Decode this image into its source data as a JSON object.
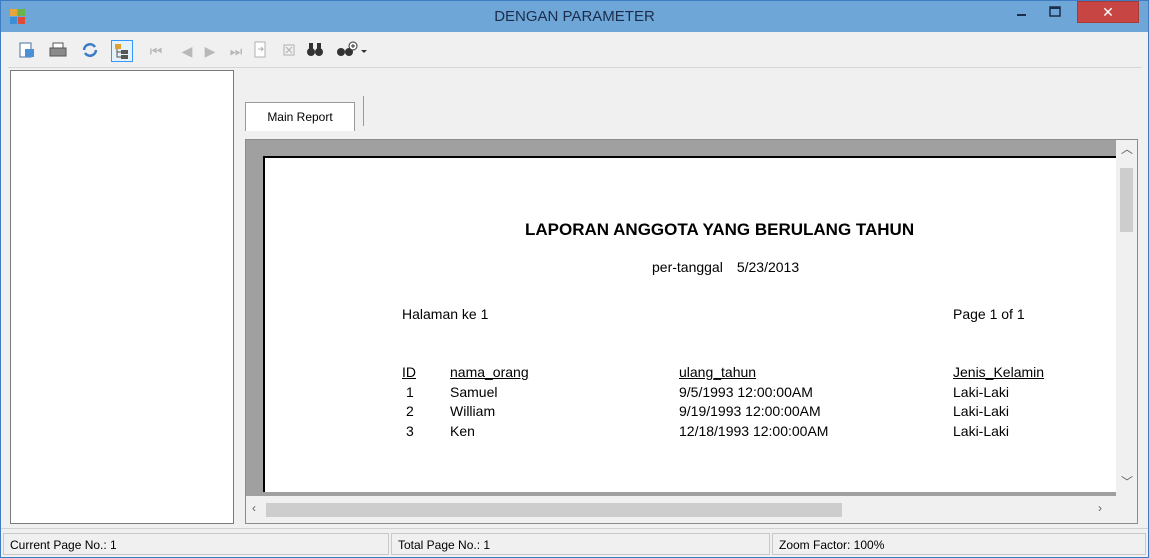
{
  "window": {
    "title": "DENGAN PARAMETER",
    "close_glyph": "✕",
    "min_glyph": "–",
    "max_glyph": "☐"
  },
  "toolbar": {
    "buttons": [
      {
        "name": "export-icon",
        "glyph": "▣"
      },
      {
        "name": "print-icon",
        "glyph": "⎙"
      },
      {
        "name": "refresh-icon",
        "glyph": "⟳"
      },
      {
        "name": "group-tree-toggle-icon",
        "glyph": "☷"
      },
      {
        "name": "first-page-icon",
        "glyph": "|◀"
      },
      {
        "name": "previous-page-icon",
        "glyph": "◀"
      },
      {
        "name": "next-page-icon",
        "glyph": "▶"
      },
      {
        "name": "last-page-icon",
        "glyph": "▶|"
      },
      {
        "name": "go-to-page-icon",
        "glyph": "⇲"
      },
      {
        "name": "stop-icon",
        "glyph": "⊠"
      },
      {
        "name": "search-text-icon",
        "glyph": "⚲"
      },
      {
        "name": "zoom-icon",
        "glyph": "⚲+"
      }
    ]
  },
  "tab": {
    "label": "Main Report"
  },
  "report": {
    "title": "LAPORAN ANGGOTA YANG BERULANG TAHUN",
    "subtitle_label": "per-tanggal",
    "subtitle_date": "5/23/2013",
    "halaman": "Halaman ke 1",
    "page_of": "Page 1 of 1",
    "columns": [
      "ID",
      "nama_orang",
      "ulang_tahun",
      "Jenis_Kelamin"
    ],
    "rows": [
      {
        "id": "1",
        "nama": "Samuel",
        "ulang": "9/5/1993  12:00:00AM",
        "jk": "Laki-Laki"
      },
      {
        "id": "2",
        "nama": "William",
        "ulang": "9/19/1993  12:00:00AM",
        "jk": "Laki-Laki"
      },
      {
        "id": "3",
        "nama": "Ken",
        "ulang": "12/18/1993  12:00:00AM",
        "jk": "Laki-Laki"
      }
    ]
  },
  "status": {
    "current_page": "Current Page No.: 1",
    "total_page": "Total Page No.: 1",
    "zoom": "Zoom Factor: 100%"
  }
}
